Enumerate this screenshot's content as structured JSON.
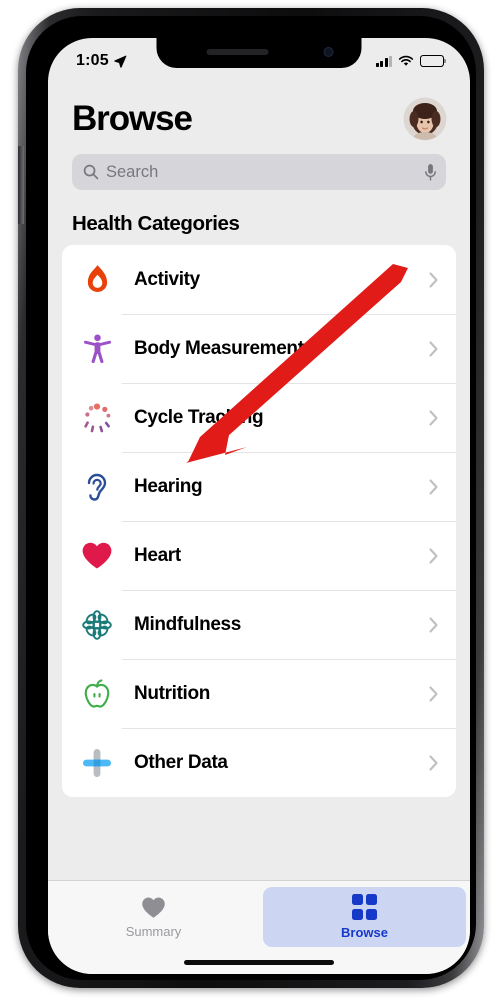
{
  "status_bar": {
    "time": "1:05",
    "location_icon": "location-arrow-icon",
    "signal_icon": "cellular-signal-icon",
    "wifi_icon": "wifi-icon",
    "battery_icon": "battery-icon"
  },
  "header": {
    "title": "Browse",
    "avatar_icon": "user-avatar"
  },
  "search": {
    "placeholder": "Search",
    "search_icon": "search-icon",
    "mic_icon": "microphone-icon"
  },
  "section": {
    "title": "Health Categories"
  },
  "categories": [
    {
      "label": "Activity",
      "icon": "flame-icon",
      "color": "#e8420a"
    },
    {
      "label": "Body Measurements",
      "icon": "body-figure-icon",
      "color": "#9b51c7"
    },
    {
      "label": "Cycle Tracking",
      "icon": "cycle-dots-icon",
      "color": "#e36b6b"
    },
    {
      "label": "Hearing",
      "icon": "ear-icon",
      "color": "#2b4e9b"
    },
    {
      "label": "Heart",
      "icon": "heart-icon",
      "color": "#e0194b"
    },
    {
      "label": "Mindfulness",
      "icon": "mandala-icon",
      "color": "#1a7a7a"
    },
    {
      "label": "Nutrition",
      "icon": "apple-icon",
      "color": "#3fae4a"
    },
    {
      "label": "Other Data",
      "icon": "plus-cross-icon",
      "color": "#4cb8f5"
    }
  ],
  "tab_bar": {
    "tabs": [
      {
        "label": "Summary",
        "icon": "heart-icon",
        "active": false
      },
      {
        "label": "Browse",
        "icon": "grid-icon",
        "active": true
      }
    ]
  },
  "annotation": {
    "type": "arrow",
    "color": "#e01b18",
    "points_to": "Cycle Tracking"
  }
}
